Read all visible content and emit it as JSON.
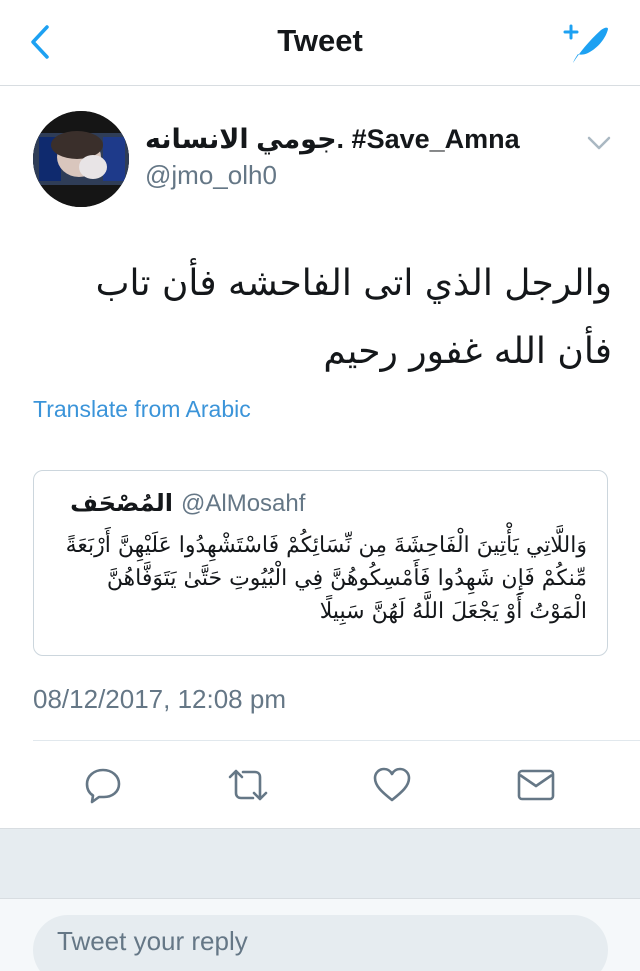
{
  "nav": {
    "title": "Tweet",
    "back_icon": "chevron-left-icon",
    "compose_icon": "compose-tweet-icon"
  },
  "tweet": {
    "display_name": "جومي الانسانه. #Save_Amna",
    "handle": "@jmo_olh0",
    "text": "والرجل الذي اتى الفاحشه فأن تاب فأن الله غفور رحيم",
    "translate_label": "Translate from Arabic",
    "timestamp": "08/12/2017, 12:08 pm"
  },
  "quoted_tweet": {
    "display_name": "المُصْحَف",
    "handle": "@AlMosahf",
    "text": "وَاللَّاتِي يَأْتِينَ الْفَاحِشَةَ مِن نِّسَائِكُمْ فَاسْتَشْهِدُوا عَلَيْهِنَّ أَرْبَعَةً مِّنكُمْ فَإِن شَهِدُوا فَأَمْسِكُوهُنَّ فِي الْبُيُوتِ حَتَّىٰ يَتَوَفَّاهُنَّ الْمَوْتُ أَوْ يَجْعَلَ اللَّهُ لَهُنَّ سَبِيلًا"
  },
  "actions": [
    {
      "name": "reply",
      "icon": "reply-icon"
    },
    {
      "name": "retweet",
      "icon": "retweet-icon"
    },
    {
      "name": "like",
      "icon": "heart-icon"
    },
    {
      "name": "direct-message",
      "icon": "envelope-icon"
    }
  ],
  "reply": {
    "placeholder": "Tweet your reply"
  },
  "colors": {
    "accent": "#1da1f2",
    "link": "#3b94d9",
    "secondary_text": "#657786",
    "border": "#d8dde1",
    "band": "#e6ecf0"
  }
}
